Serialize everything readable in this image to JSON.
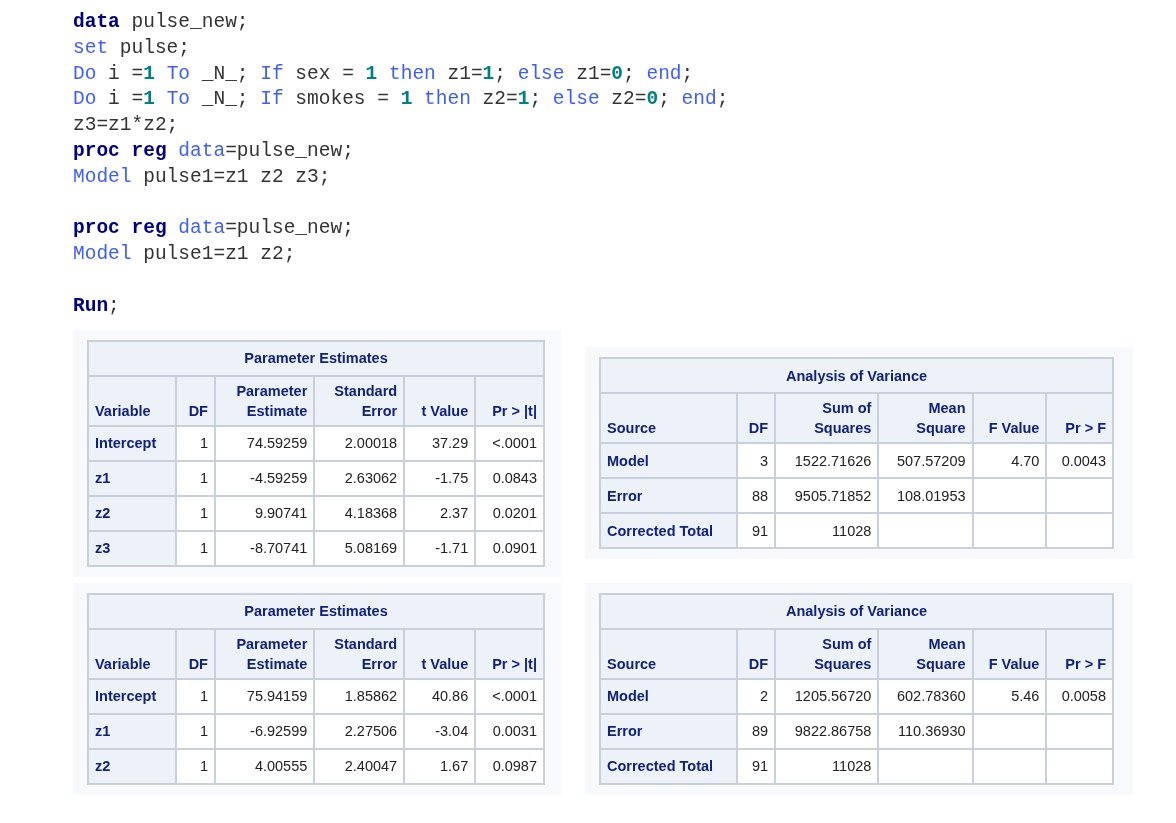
{
  "code_blocks": [
    [
      {
        "tokens": [
          {
            "t": "data",
            "kind": "keyword"
          },
          {
            "t": " pulse_new;",
            "kind": "plain"
          }
        ]
      },
      {
        "tokens": [
          {
            "t": "set",
            "kind": "statement"
          },
          {
            "t": " pulse;",
            "kind": "plain"
          }
        ]
      },
      {
        "tokens": [
          {
            "t": "Do",
            "kind": "statement"
          },
          {
            "t": " i =",
            "kind": "plain"
          },
          {
            "t": "1 ",
            "kind": "number"
          },
          {
            "t": "To",
            "kind": "statement"
          },
          {
            "t": " _N_; ",
            "kind": "plain"
          },
          {
            "t": "If",
            "kind": "statement"
          },
          {
            "t": " sex = ",
            "kind": "plain"
          },
          {
            "t": "1 ",
            "kind": "number"
          },
          {
            "t": "then",
            "kind": "statement"
          },
          {
            "t": " z1=",
            "kind": "plain"
          },
          {
            "t": "1",
            "kind": "number"
          },
          {
            "t": "; ",
            "kind": "plain"
          },
          {
            "t": "else",
            "kind": "statement"
          },
          {
            "t": " z1=",
            "kind": "plain"
          },
          {
            "t": "0",
            "kind": "number"
          },
          {
            "t": "; ",
            "kind": "plain"
          },
          {
            "t": "end",
            "kind": "statement"
          },
          {
            "t": ";",
            "kind": "plain"
          }
        ]
      },
      {
        "tokens": [
          {
            "t": "Do",
            "kind": "statement"
          },
          {
            "t": " i =",
            "kind": "plain"
          },
          {
            "t": "1 ",
            "kind": "number"
          },
          {
            "t": "To",
            "kind": "statement"
          },
          {
            "t": " _N_; ",
            "kind": "plain"
          },
          {
            "t": "If",
            "kind": "statement"
          },
          {
            "t": " smokes = ",
            "kind": "plain"
          },
          {
            "t": "1 ",
            "kind": "number"
          },
          {
            "t": "then",
            "kind": "statement"
          },
          {
            "t": " z2=",
            "kind": "plain"
          },
          {
            "t": "1",
            "kind": "number"
          },
          {
            "t": "; ",
            "kind": "plain"
          },
          {
            "t": "else",
            "kind": "statement"
          },
          {
            "t": " z2=",
            "kind": "plain"
          },
          {
            "t": "0",
            "kind": "number"
          },
          {
            "t": "; ",
            "kind": "plain"
          },
          {
            "t": "end",
            "kind": "statement"
          },
          {
            "t": ";",
            "kind": "plain"
          }
        ]
      },
      {
        "tokens": [
          {
            "t": "z3=z1*z2;",
            "kind": "plain"
          }
        ]
      },
      {
        "tokens": [
          {
            "t": "proc reg ",
            "kind": "keyword"
          },
          {
            "t": "data",
            "kind": "statement"
          },
          {
            "t": "=pulse_new;",
            "kind": "plain"
          }
        ]
      },
      {
        "tokens": [
          {
            "t": "Model",
            "kind": "statement"
          },
          {
            "t": " pulse1=z1 z2 z3;",
            "kind": "plain"
          }
        ]
      }
    ],
    [
      {
        "tokens": [
          {
            "t": "proc reg ",
            "kind": "keyword"
          },
          {
            "t": "data",
            "kind": "statement"
          },
          {
            "t": "=pulse_new;",
            "kind": "plain"
          }
        ]
      },
      {
        "tokens": [
          {
            "t": "Model",
            "kind": "statement"
          },
          {
            "t": " pulse1=z1 z2;",
            "kind": "plain"
          }
        ]
      }
    ],
    [
      {
        "tokens": [
          {
            "t": "Run",
            "kind": "keyword"
          },
          {
            "t": ";",
            "kind": "plain"
          }
        ]
      }
    ]
  ],
  "outputs": [
    {
      "parameter_estimates": {
        "title": "Parameter Estimates",
        "columns": [
          "Variable",
          "DF",
          "Parameter\nEstimate",
          "Standard\nError",
          "t Value",
          "Pr > |t|"
        ],
        "rows": [
          [
            "Intercept",
            "1",
            "74.59259",
            "2.00018",
            "37.29",
            "<.0001"
          ],
          [
            "z1",
            "1",
            "-4.59259",
            "2.63062",
            "-1.75",
            "0.0843"
          ],
          [
            "z2",
            "1",
            "9.90741",
            "4.18368",
            "2.37",
            "0.0201"
          ],
          [
            "z3",
            "1",
            "-8.70741",
            "5.08169",
            "-1.71",
            "0.0901"
          ]
        ]
      },
      "anova": {
        "title": "Analysis of Variance",
        "columns": [
          "Source",
          "DF",
          "Sum of\nSquares",
          "Mean\nSquare",
          "F Value",
          "Pr > F"
        ],
        "rows": [
          [
            "Model",
            "3",
            "1522.71626",
            "507.57209",
            "4.70",
            "0.0043"
          ],
          [
            "Error",
            "88",
            "9505.71852",
            "108.01953"
          ],
          [
            "Corrected Total",
            "91",
            "11028"
          ]
        ]
      }
    },
    {
      "parameter_estimates": {
        "title": "Parameter Estimates",
        "columns": [
          "Variable",
          "DF",
          "Parameter\nEstimate",
          "Standard\nError",
          "t Value",
          "Pr > |t|"
        ],
        "rows": [
          [
            "Intercept",
            "1",
            "75.94159",
            "1.85862",
            "40.86",
            "<.0001"
          ],
          [
            "z1",
            "1",
            "-6.92599",
            "2.27506",
            "-3.04",
            "0.0031"
          ],
          [
            "z2",
            "1",
            "4.00555",
            "2.40047",
            "1.67",
            "0.0987"
          ]
        ]
      },
      "anova": {
        "title": "Analysis of Variance",
        "columns": [
          "Source",
          "DF",
          "Sum of\nSquares",
          "Mean\nSquare",
          "F Value",
          "Pr > F"
        ],
        "rows": [
          [
            "Model",
            "2",
            "1205.56720",
            "602.78360",
            "5.46",
            "0.0058"
          ],
          [
            "Error",
            "89",
            "9822.86758",
            "110.36930"
          ],
          [
            "Corrected Total",
            "91",
            "11028"
          ]
        ]
      }
    }
  ]
}
